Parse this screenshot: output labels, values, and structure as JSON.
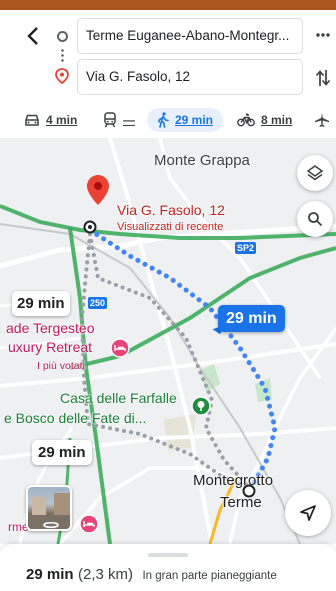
{
  "header": {
    "origin": "Terme Euganee-Abano-Montegr...",
    "destination": "Via G. Fasolo, 12"
  },
  "modes": [
    {
      "name": "car",
      "label": "4 min",
      "active": false
    },
    {
      "name": "transit",
      "label": "—",
      "active": false
    },
    {
      "name": "walk",
      "label": "29 min",
      "active": true
    },
    {
      "name": "bike",
      "label": "8 min",
      "active": false
    },
    {
      "name": "flight",
      "label": "",
      "active": false
    }
  ],
  "map": {
    "labels": {
      "grappa": "Monte Grappa",
      "destination_name": "Via G. Fasolo, 12",
      "destination_sub": "Visualizzati di recente",
      "sp2": "SP2",
      "road_250": "250",
      "hotel_line1": "ade Tergesteo",
      "hotel_line2": "uxury Retreat",
      "hotel_badge": "I più votati",
      "farfalle_line1": "Casa delle Farfalle",
      "farfalle_line2": "e Bosco delle Fate di...",
      "monte_terme_1": "Montegrotto",
      "monte_terme_2": "Terme",
      "terme_poi": "rme"
    },
    "chips": {
      "best": "29 min",
      "alt1": "29 min",
      "alt2": "29 min"
    },
    "colors": {
      "route": "#4285f4",
      "alt_route": "#9aa0a6",
      "dest_pin": "#ea4335",
      "traffic": "#34a853"
    }
  },
  "summary": {
    "duration": "29 min",
    "distance": "(2,3 km)",
    "description": "In gran parte pianeggiante"
  }
}
